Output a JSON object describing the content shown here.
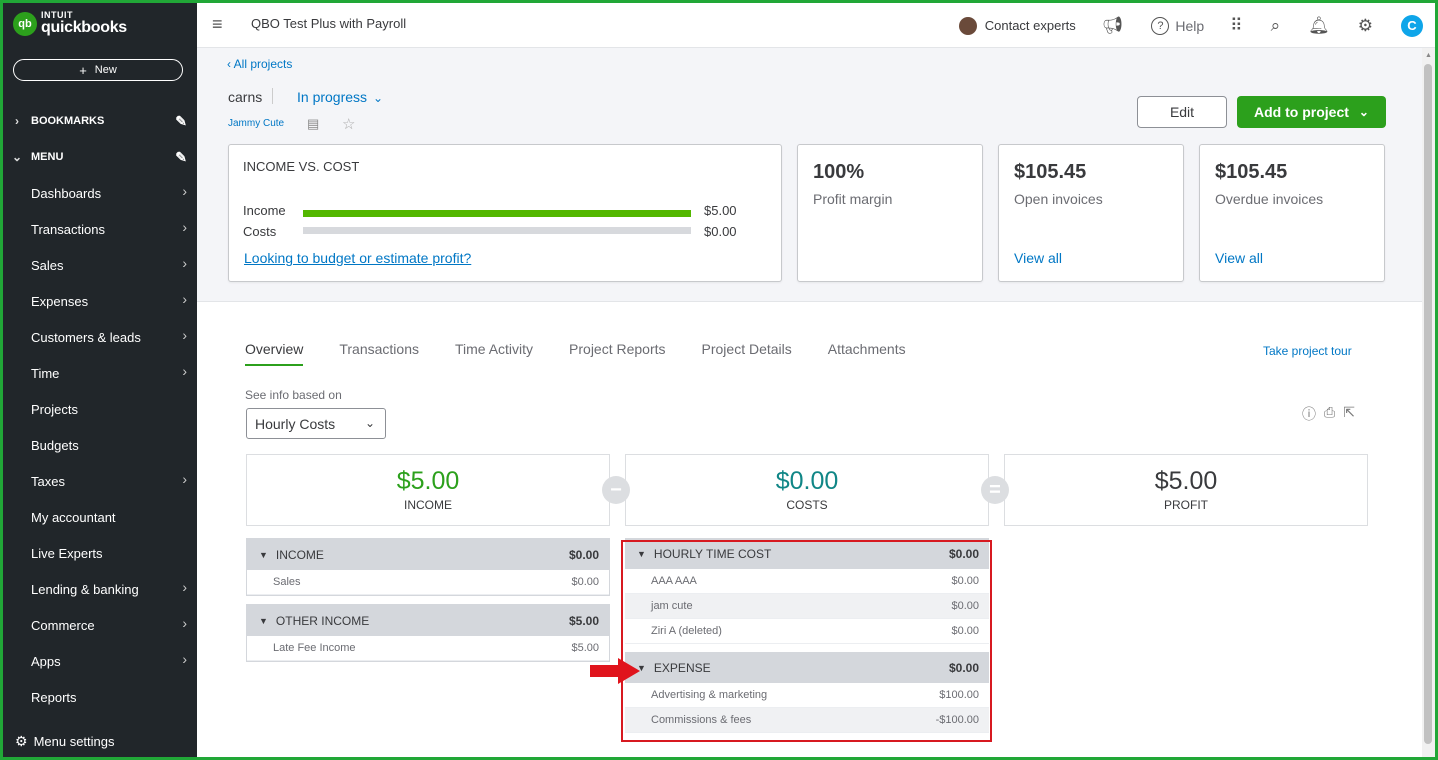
{
  "sidebar": {
    "logo_top": "INTUIT",
    "logo_bottom": "quickbooks",
    "logo_mark": "qb",
    "new_label": "New",
    "bookmarks_label": "BOOKMARKS",
    "menu_label": "MENU",
    "items": [
      {
        "label": "Dashboards",
        "has_arrow": true
      },
      {
        "label": "Transactions",
        "has_arrow": true
      },
      {
        "label": "Sales",
        "has_arrow": true
      },
      {
        "label": "Expenses",
        "has_arrow": true
      },
      {
        "label": "Customers & leads",
        "has_arrow": true
      },
      {
        "label": "Time",
        "has_arrow": true
      },
      {
        "label": "Projects",
        "has_arrow": false
      },
      {
        "label": "Budgets",
        "has_arrow": false
      },
      {
        "label": "Taxes",
        "has_arrow": true
      },
      {
        "label": "My accountant",
        "has_arrow": false
      },
      {
        "label": "Live Experts",
        "has_arrow": false
      },
      {
        "label": "Lending & banking",
        "has_arrow": true
      },
      {
        "label": "Commerce",
        "has_arrow": true
      },
      {
        "label": "Apps",
        "has_arrow": true
      },
      {
        "label": "Reports",
        "has_arrow": false
      }
    ],
    "menu_settings_label": "Menu settings"
  },
  "topbar": {
    "company": "QBO Test Plus with Payroll",
    "contact_label": "Contact experts",
    "help_label": "Help",
    "user_initial": "C"
  },
  "project": {
    "back_label": "All projects",
    "name": "carns",
    "status": "In progress",
    "customer": "Jammy Cute",
    "edit_label": "Edit",
    "add_label": "Add to project"
  },
  "income_vs_cost": {
    "title": "INCOME VS. COST",
    "income_label": "Income",
    "income_value": "$5.00",
    "income_fraction": 1.0,
    "costs_label": "Costs",
    "costs_value": "$0.00",
    "costs_fraction": 0.0,
    "link": "Looking to budget or estimate profit?"
  },
  "metrics": [
    {
      "value": "100%",
      "label": "Profit margin",
      "link": ""
    },
    {
      "value": "$105.45",
      "label": "Open invoices",
      "link": "View all"
    },
    {
      "value": "$105.45",
      "label": "Overdue invoices",
      "link": "View all"
    }
  ],
  "tabs": [
    "Overview",
    "Transactions",
    "Time Activity",
    "Project Reports",
    "Project Details",
    "Attachments"
  ],
  "tour_label": "Take project tour",
  "see_info_label": "See info based on",
  "basis_value": "Hourly Costs",
  "summary": {
    "income": {
      "amount": "$5.00",
      "label": "INCOME",
      "color": "#2ca01c"
    },
    "costs": {
      "amount": "$0.00",
      "label": "COSTS",
      "color": "#108686"
    },
    "profit": {
      "amount": "$5.00",
      "label": "PROFIT",
      "color": "#393a3d"
    },
    "minus": "−",
    "equals": "="
  },
  "income_sections": [
    {
      "name": "INCOME",
      "total": "$0.00",
      "rows": [
        {
          "name": "Sales",
          "amount": "$0.00"
        }
      ]
    },
    {
      "name": "OTHER INCOME",
      "total": "$5.00",
      "rows": [
        {
          "name": "Late Fee Income",
          "amount": "$5.00"
        }
      ]
    }
  ],
  "cost_sections": [
    {
      "name": "HOURLY TIME COST",
      "total": "$0.00",
      "rows": [
        {
          "name": "AAA AAA",
          "amount": "$0.00"
        },
        {
          "name": "jam cute",
          "amount": "$0.00"
        },
        {
          "name": "Ziri A (deleted)",
          "amount": "$0.00"
        }
      ]
    },
    {
      "name": "EXPENSE",
      "total": "$0.00",
      "rows": [
        {
          "name": "Advertising & marketing",
          "amount": "$100.00"
        },
        {
          "name": "Commissions & fees",
          "amount": "-$100.00"
        }
      ]
    }
  ],
  "colors": {
    "frame": "#21a737",
    "brand_green": "#2ca01c",
    "link_blue": "#0077c5",
    "highlight_red": "#d71920"
  }
}
